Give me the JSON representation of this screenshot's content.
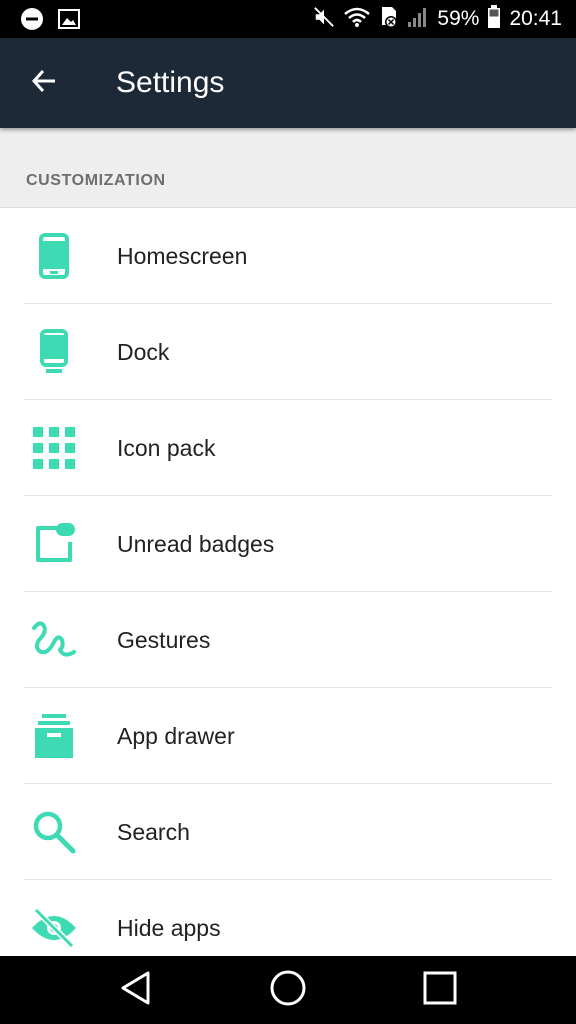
{
  "status_bar": {
    "battery_percent": "59%",
    "time": "20:41",
    "icons": [
      "minus-circle-icon",
      "image-icon",
      "mute-icon",
      "wifi-icon",
      "sim-blocked-icon",
      "signal-icon",
      "battery-icon"
    ]
  },
  "app_bar": {
    "title": "Settings",
    "back_icon": "arrow-left-icon"
  },
  "section": {
    "label": "CUSTOMIZATION"
  },
  "items": [
    {
      "label": "Homescreen",
      "icon": "phone-icon"
    },
    {
      "label": "Dock",
      "icon": "dock-icon"
    },
    {
      "label": "Icon pack",
      "icon": "grid-icon"
    },
    {
      "label": "Unread badges",
      "icon": "badge-icon"
    },
    {
      "label": "Gestures",
      "icon": "gesture-icon"
    },
    {
      "label": "App drawer",
      "icon": "archive-icon"
    },
    {
      "label": "Search",
      "icon": "search-icon"
    },
    {
      "label": "Hide apps",
      "icon": "eye-off-icon"
    }
  ],
  "nav_bar": {
    "icons": [
      "back-triangle-icon",
      "home-circle-icon",
      "recents-square-icon"
    ]
  },
  "colors": {
    "accent": "#3ddab4",
    "app_bar": "#1e2938",
    "section_bg": "#eeeeee"
  }
}
